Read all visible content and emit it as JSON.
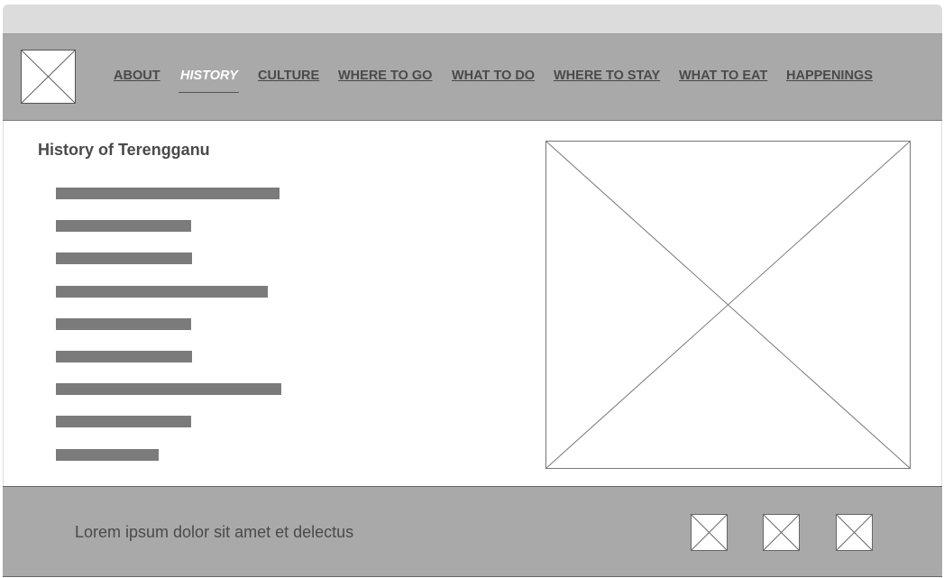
{
  "header": {
    "logo_icon": "image-placeholder-icon",
    "nav": [
      {
        "label": "ABOUT",
        "active": false
      },
      {
        "label": "HISTORY",
        "active": true
      },
      {
        "label": "CULTURE",
        "active": false
      },
      {
        "label": "WHERE TO GO",
        "active": false
      },
      {
        "label": "WHAT TO DO",
        "active": false
      },
      {
        "label": "WHERE TO STAY",
        "active": false
      },
      {
        "label": "WHAT TO EAT",
        "active": false
      },
      {
        "label": "HAPPENINGS",
        "active": false
      }
    ]
  },
  "main": {
    "title": "History of Terengganu",
    "hero_icon": "image-placeholder-icon"
  },
  "footer": {
    "text": "Lorem ipsum dolor sit amet et delectus",
    "social_icons": [
      "image-placeholder-icon",
      "image-placeholder-icon",
      "image-placeholder-icon"
    ]
  },
  "colors": {
    "header_bg": "#a9a9a9",
    "topbar_bg": "#dcdcdc",
    "text_bar": "#7b7b7b",
    "active_nav": "#ffffff",
    "nav_text": "#4a4a4a"
  }
}
